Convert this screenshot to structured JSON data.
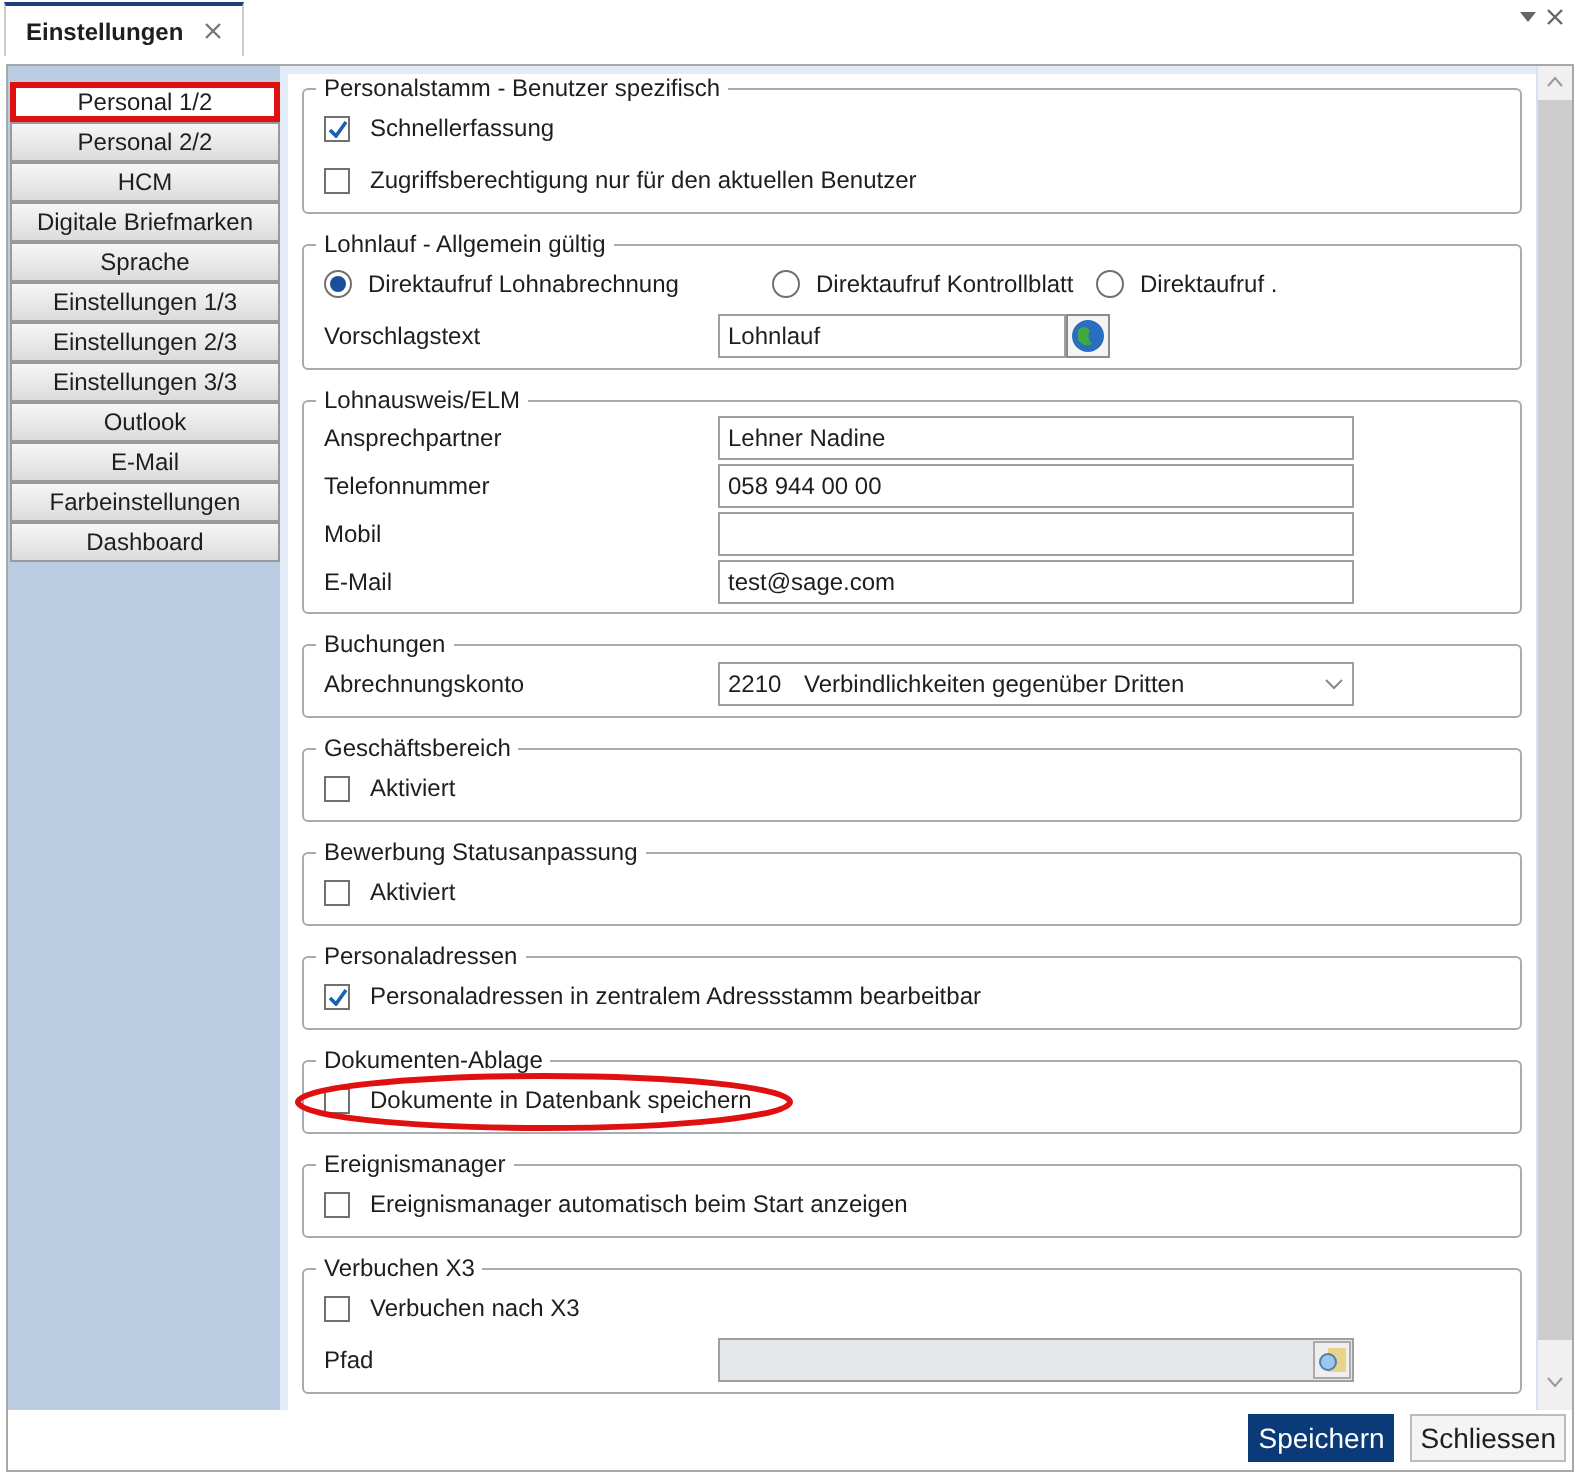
{
  "tab": {
    "title": "Einstellungen",
    "selected": true
  },
  "sidebar": {
    "items": [
      {
        "label": "Personal 1/2",
        "selected": true,
        "highlighted": true
      },
      {
        "label": "Personal 2/2",
        "selected": false,
        "highlighted": false
      },
      {
        "label": "HCM",
        "selected": false,
        "highlighted": false
      },
      {
        "label": "Digitale Briefmarken",
        "selected": false,
        "highlighted": false
      },
      {
        "label": "Sprache",
        "selected": false,
        "highlighted": false
      },
      {
        "label": "Einstellungen 1/3",
        "selected": false,
        "highlighted": false
      },
      {
        "label": "Einstellungen 2/3",
        "selected": false,
        "highlighted": false
      },
      {
        "label": "Einstellungen 3/3",
        "selected": false,
        "highlighted": false
      },
      {
        "label": "Outlook",
        "selected": false,
        "highlighted": false
      },
      {
        "label": "E-Mail",
        "selected": false,
        "highlighted": false
      },
      {
        "label": "Farbeinstellungen",
        "selected": false,
        "highlighted": false
      },
      {
        "label": "Dashboard",
        "selected": false,
        "highlighted": false
      }
    ]
  },
  "groups": [
    {
      "title": "Personalstamm - Benutzer spezifisch",
      "rows": [
        {
          "kind": "checkbox",
          "label": "Schnellerfassung",
          "checked": true,
          "highlighted": false
        },
        {
          "kind": "checkbox",
          "label": "Zugriffsberechtigung nur für den aktuellen Benutzer",
          "checked": false,
          "highlighted": false
        }
      ]
    },
    {
      "title": "Lohnlauf - Allgemein gültig",
      "rows": [
        {
          "kind": "radios",
          "options": [
            {
              "label": "Direktaufruf Lohnabrechnung",
              "selected": true
            },
            {
              "label": "Direktaufruf Kontrollblatt",
              "selected": false
            },
            {
              "label": "Direktaufruf .",
              "selected": false
            }
          ]
        },
        {
          "kind": "picker",
          "label": "Vorschlagstext",
          "value": "Lohnlauf",
          "disabled": false
        }
      ]
    },
    {
      "title": "Lohnausweis/ELM",
      "rows": [
        {
          "kind": "field",
          "label": "Ansprechpartner",
          "value": "Lehner Nadine"
        },
        {
          "kind": "field",
          "label": "Telefonnummer",
          "value": "058 944 00 00"
        },
        {
          "kind": "field",
          "label": "Mobil"
        },
        {
          "kind": "field",
          "label": "E-Mail",
          "value": "test@sage.com"
        }
      ]
    },
    {
      "title": "Buchungen",
      "rows": [
        {
          "kind": "dropdown",
          "label": "Abrechnungskonto",
          "code": "2210",
          "value": "Verbindlichkeiten gegenüber Dritten"
        }
      ]
    },
    {
      "title": "Geschäftsbereich",
      "rows": [
        {
          "kind": "checkbox",
          "label": "Aktiviert",
          "checked": false,
          "highlighted": false
        }
      ]
    },
    {
      "title": "Bewerbung Statusanpassung",
      "rows": [
        {
          "kind": "checkbox",
          "label": "Aktiviert",
          "checked": false,
          "highlighted": false
        }
      ]
    },
    {
      "title": "Personaladressen",
      "rows": [
        {
          "kind": "checkbox",
          "label": "Personaladressen in zentralem Adressstamm bearbeitbar",
          "checked": true,
          "highlighted": false
        }
      ]
    },
    {
      "title": "Dokumenten-Ablage",
      "rows": [
        {
          "kind": "checkbox",
          "label": "Dokumente in Datenbank speichern",
          "checked": false,
          "highlighted": true
        }
      ]
    },
    {
      "title": "Ereignismanager",
      "rows": [
        {
          "kind": "checkbox",
          "label": "Ereignismanager automatisch beim Start anzeigen",
          "checked": false,
          "highlighted": false
        }
      ]
    },
    {
      "title": "Verbuchen X3",
      "rows": [
        {
          "kind": "checkbox",
          "label": "Verbuchen nach X3",
          "checked": false,
          "highlighted": false
        },
        {
          "kind": "picker",
          "label": "Pfad",
          "disabled": true
        }
      ]
    }
  ],
  "buttons": [
    {
      "label": "Speichern",
      "primary": true
    },
    {
      "label": "Schliessen",
      "primary": false
    }
  ]
}
